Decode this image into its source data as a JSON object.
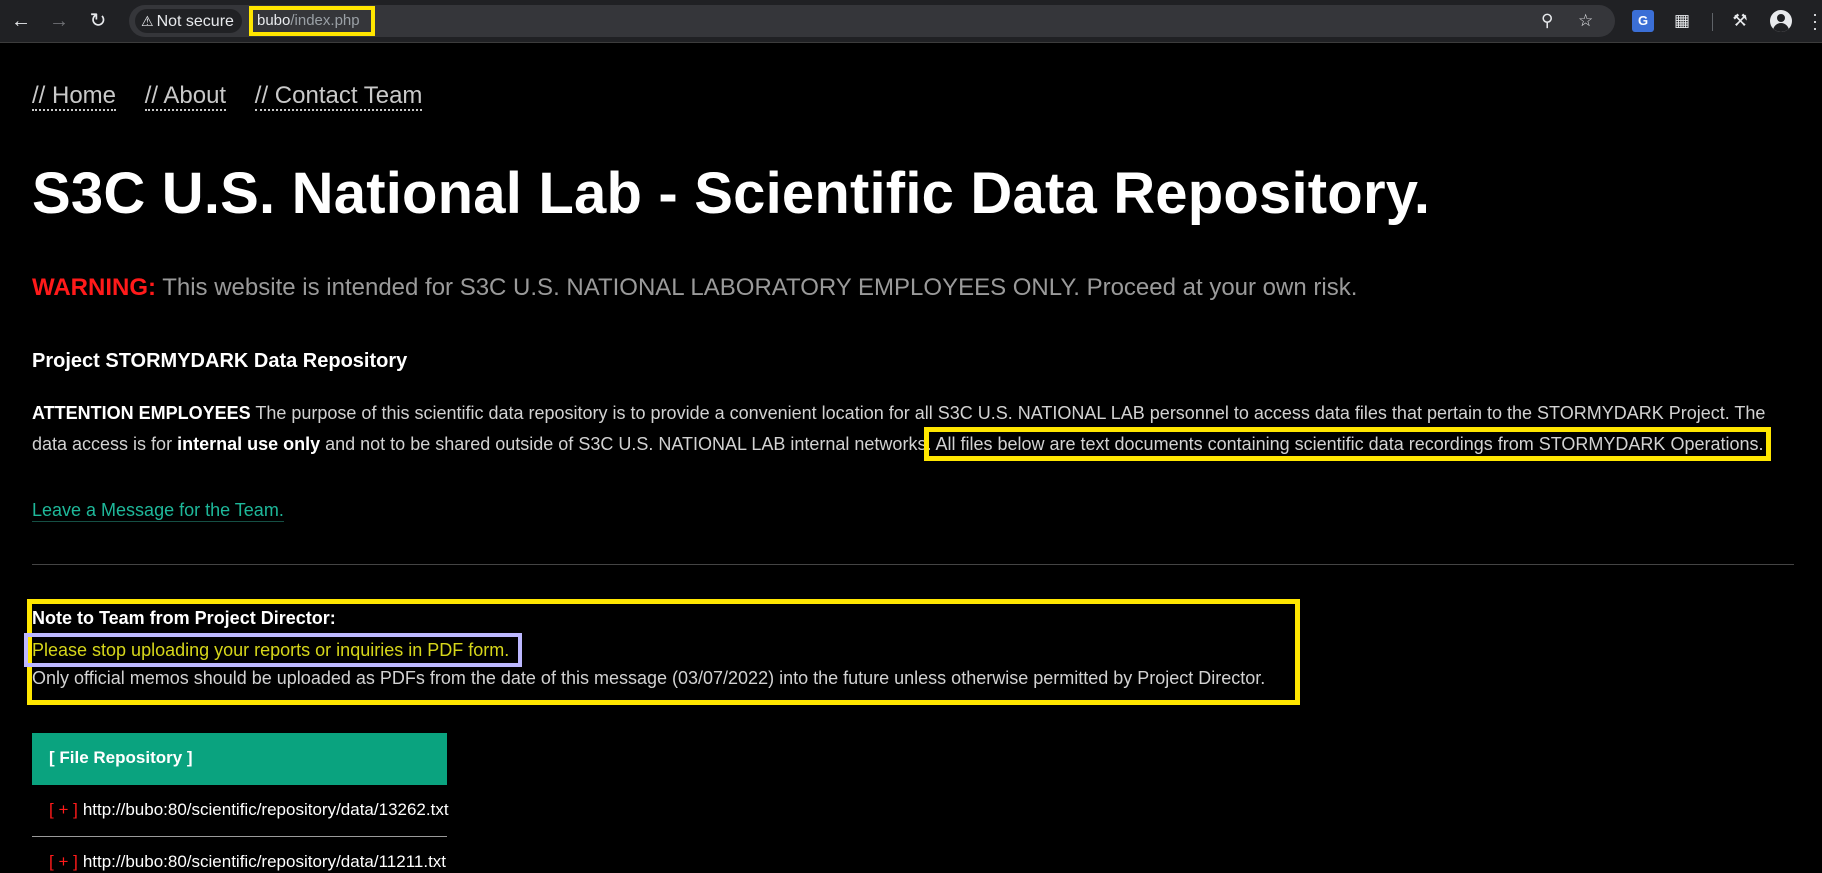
{
  "browser": {
    "security_label": "Not secure",
    "url_host": "bubo",
    "url_path": "/index.php",
    "icons": [
      "back-icon",
      "forward-icon",
      "reload-icon",
      "warning-icon",
      "zoom-icon",
      "bookmark-star-icon",
      "translate-icon",
      "extensions-icon",
      "labs-flask-icon",
      "profile-icon",
      "menu-kebab-icon"
    ]
  },
  "nav": {
    "home": "// Home",
    "about": "// About",
    "contact": "// Contact Team"
  },
  "page": {
    "title": "S3C U.S. National Lab - Scientific Data Repository.",
    "warning_label": "WARNING:",
    "warning_text": " This website is intended for S3C U.S. NATIONAL LABORATORY EMPLOYEES ONLY. Proceed at your own risk.",
    "section_heading": "Project STORMYDARK Data Repository",
    "intro_bold": "ATTENTION EMPLOYEES",
    "intro_text_1": " The purpose of this scientific data repository is to provide a convenient location for all S3C U.S. NATIONAL LAB personnel to access data files that pertain to the STORMYDARK Project. The data access is for ",
    "intro_bold_2": "internal use only",
    "intro_text_2": " and not to be shared outside of S3C U.S. NATIONAL LAB internal networks.",
    "intro_highlight": " All files below are text documents containing scientific data recordings from STORMYDARK Operations.",
    "message_link": "Leave a Message for the Team."
  },
  "note": {
    "title": "Note to Team from Project Director:",
    "highlight": "Please stop uploading your reports or inquiries in PDF form.",
    "body": "Only official memos should be uploaded as PDFs from the date of this message (03/07/2022) into the future unless otherwise permitted by Project Director."
  },
  "repository": {
    "header": "[ File Repository ]",
    "bullet": "[ + ]",
    "files": [
      "http://bubo:80/scientific/repository/data/13262.txt",
      "http://bubo:80/scientific/repository/data/11211.txt"
    ]
  },
  "colors": {
    "highlight_yellow": "#ffe600",
    "highlight_lavender": "#bdb8ff",
    "warning_red": "#ff1a1a",
    "link_teal": "#1eb89a",
    "repo_header_green": "#0aa37f"
  }
}
